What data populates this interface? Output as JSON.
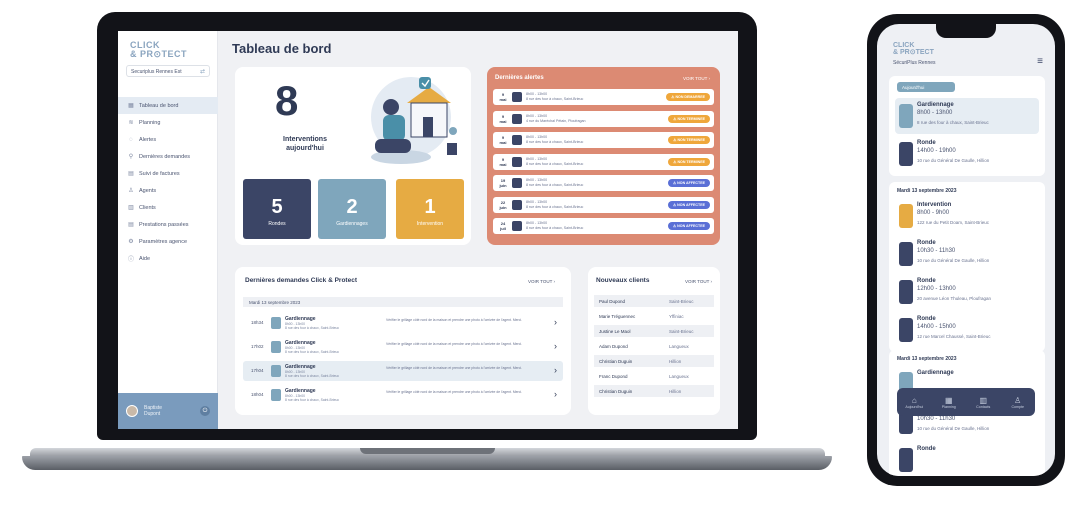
{
  "app": {
    "logo_line1": "CLICK",
    "logo_line2": "& PR⊙TECT",
    "org": "Securiplus Rennes Est",
    "page_title": "Tableau de bord"
  },
  "sidebar": {
    "items": [
      {
        "icon": "dashboard-icon",
        "glyph": "▦",
        "label": "Tableau de bord",
        "active": true
      },
      {
        "icon": "planning-icon",
        "glyph": "≋",
        "label": "Planning"
      },
      {
        "icon": "bell-icon",
        "glyph": "◌",
        "label": "Alertes"
      },
      {
        "icon": "requests-icon",
        "glyph": "⚲",
        "label": "Dernières demandes"
      },
      {
        "icon": "invoice-icon",
        "glyph": "▤",
        "label": "Suivi de factures"
      },
      {
        "icon": "agents-icon",
        "glyph": "♙",
        "label": "Agents"
      },
      {
        "icon": "clients-icon",
        "glyph": "▥",
        "label": "Clients"
      },
      {
        "icon": "services-icon",
        "glyph": "▤",
        "label": "Prestations passées"
      },
      {
        "icon": "settings-icon",
        "glyph": "⚙",
        "label": "Paramètres agence"
      },
      {
        "icon": "help-icon",
        "glyph": "ⓘ",
        "label": "Aide"
      }
    ],
    "user_line1": "Baptiste",
    "user_line2": "Dupont"
  },
  "hero": {
    "count": "8",
    "label_line1": "Interventions",
    "label_line2": "aujourd'hui"
  },
  "stats": [
    {
      "value": "5",
      "label": "Rondes"
    },
    {
      "value": "2",
      "label": "Gardiennages"
    },
    {
      "value": "1",
      "label": "Intervention"
    }
  ],
  "alerts": {
    "title": "Dernières alertes",
    "link": "VOIR TOUT ›",
    "rows": [
      {
        "day": "9",
        "month": "mai",
        "time": "8h00 - 13h00",
        "addr": "8 rue des four à chaux, Saint-Brieuc",
        "badge": "⚠ NON DEMARREE",
        "kind": "orange"
      },
      {
        "day": "9",
        "month": "mai",
        "time": "8h00 - 13h00",
        "addr": "4 rue du Maréchal Pétain, Ploufragan",
        "badge": "⚠ NON TERMINEE",
        "kind": "orange"
      },
      {
        "day": "9",
        "month": "mai",
        "time": "8h00 - 13h00",
        "addr": "8 rue des four à chaux, Saint-Brieuc",
        "badge": "⚠ NON TERMINEE",
        "kind": "orange"
      },
      {
        "day": "9",
        "month": "mai",
        "time": "8h00 - 13h00",
        "addr": "8 rue des four à chaux, Saint-Brieuc",
        "badge": "⚠ NON TERMINEE",
        "kind": "orange"
      },
      {
        "day": "19",
        "month": "juin",
        "time": "8h00 - 13h00",
        "addr": "8 rue des four à chaux, Saint-Brieuc",
        "badge": "⚠ NON AFFECTEE",
        "kind": "blue"
      },
      {
        "day": "22",
        "month": "juin",
        "time": "8h00 - 13h00",
        "addr": "8 rue des four à chaux, Saint-Brieuc",
        "badge": "⚠ NON AFFECTEE",
        "kind": "blue"
      },
      {
        "day": "24",
        "month": "juil",
        "time": "8h00 - 13h00",
        "addr": "8 rue des four à chaux, Saint-Brieuc",
        "badge": "⚠ NON AFFECTEE",
        "kind": "blue"
      }
    ]
  },
  "demandes": {
    "title": "Dernières demandes Click & Protect",
    "link": "VOIR TOUT ›",
    "date": "Mardi 13 septembre 2023",
    "rows": [
      {
        "time": "18h34",
        "name": "Gardiennage",
        "hours": "8h00 - 13h00",
        "addr": "8 rue des four à chaux, Saint-Brieuc",
        "desc": "Vérifier le grillage côté nord de la maison et prendre une photo à l'arrivée de l'agent. Merci.",
        "alt": false
      },
      {
        "time": "17h02",
        "name": "Gardiennage",
        "hours": "8h00 - 13h00",
        "addr": "8 rue des four à chaux, Saint-Brieuc",
        "desc": "Vérifier le grillage côté nord de la maison et prendre une photo à l'arrivée de l'agent. Merci.",
        "alt": false
      },
      {
        "time": "17h04",
        "name": "Gardiennage",
        "hours": "8h00 - 13h00",
        "addr": "8 rue des four à chaux, Saint-Brieuc",
        "desc": "Vérifier le grillage côté nord de la maison et prendre une photo à l'arrivée de l'agent. Merci.",
        "alt": true
      },
      {
        "time": "18h04",
        "name": "Gardiennage",
        "hours": "8h00 - 13h00",
        "addr": "8 rue des four à chaux, Saint-Brieuc",
        "desc": "Vérifier le grillage côté nord de la maison et prendre une photo à l'arrivée de l'agent. Merci.",
        "alt": false
      }
    ]
  },
  "clients": {
    "title": "Nouveaux clients",
    "link": "VOIR TOUT ›",
    "rows": [
      {
        "name": "Paul Dupond",
        "city": "Saint-Brieuc"
      },
      {
        "name": "Marie Tréguennec",
        "city": "Yffiniac"
      },
      {
        "name": "Justine Le Maol",
        "city": "Saint-Brieuc"
      },
      {
        "name": "Adam Dupond",
        "city": "Langueux"
      },
      {
        "name": "Christian Duguin",
        "city": "Hillion"
      },
      {
        "name": "Franc Dupond",
        "city": "Langueux"
      },
      {
        "name": "Christian Duguin",
        "city": "Hillion"
      }
    ]
  },
  "phone": {
    "logo_line1": "CLICK",
    "logo_line2": "& PR⊙TECT",
    "org": "SécuriPlus Rennes",
    "today": "Aujourd'hui",
    "day2": "Mardi 13 septembre 2023",
    "day3": "Mardi 13 septembre 2023",
    "today_items": [
      {
        "title": "Gardiennage",
        "time": "8h00 - 13h00",
        "addr": "8 rue des four à chaux, Saint-Brieuc",
        "color": "#7fa6bc"
      },
      {
        "title": "Ronde",
        "time": "14h00 - 19h00",
        "addr": "10 rue du Général De Gaulle, Hillion",
        "color": "#3b4566"
      }
    ],
    "day2_items": [
      {
        "title": "Intervention",
        "time": "8h00 - 9h00",
        "addr": "122 rue du Petit Doam, Saint-Brieuc",
        "color": "#e6ab43"
      },
      {
        "title": "Ronde",
        "time": "10h30 - 11h30",
        "addr": "10 rue du Général De Gaulle, Hillion",
        "color": "#3b4566"
      },
      {
        "title": "Ronde",
        "time": "12h00 - 13h00",
        "addr": "20 avenue Léon Thuleau, Ploufragan",
        "color": "#3b4566"
      },
      {
        "title": "Ronde",
        "time": "14h00 - 15h00",
        "addr": "12 rue Marcel Chaussé, Saint-Brieuc",
        "color": "#3b4566"
      }
    ],
    "day3_items": [
      {
        "title": "Gardiennage",
        "time": "",
        "addr": "",
        "color": "#7fa6bc"
      },
      {
        "title": "",
        "time": "10h30 - 11h30",
        "addr": "10 rue du Général De Gaulle, Hillion",
        "color": "#3b4566"
      },
      {
        "title": "Ronde",
        "time": "",
        "addr": "",
        "color": "#3b4566"
      }
    ],
    "tabs": [
      {
        "icon": "home-icon",
        "glyph": "⌂",
        "label": "Aujourd'hui"
      },
      {
        "icon": "calendar-icon",
        "glyph": "▦",
        "label": "Planning"
      },
      {
        "icon": "contacts-icon",
        "glyph": "▥",
        "label": "Contacts"
      },
      {
        "icon": "account-icon",
        "glyph": "♙",
        "label": "Compte"
      }
    ]
  }
}
